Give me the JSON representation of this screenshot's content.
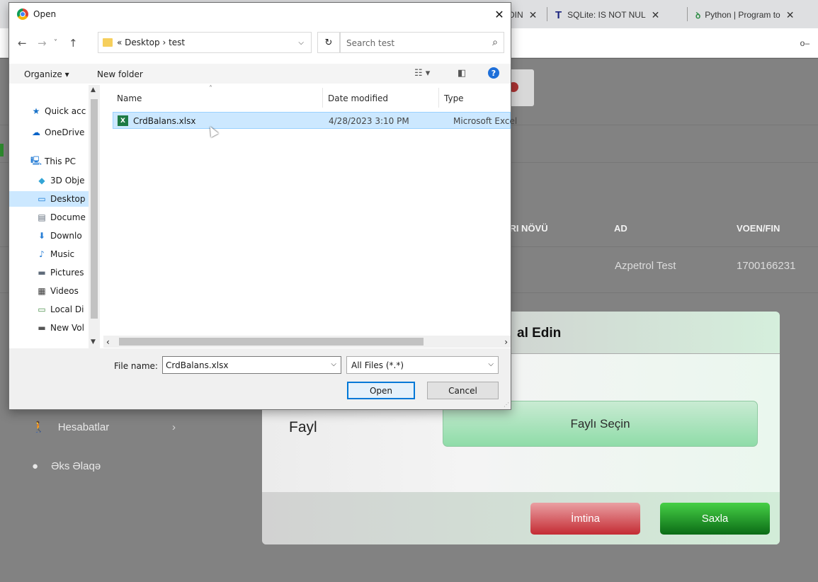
{
  "browser": {
    "tabs": [
      {
        "label": "DIN"
      },
      {
        "label": "SQLite: IS NOT NUL",
        "icon": "T"
      },
      {
        "label": "Python | Program to",
        "icon": "ꝺ"
      }
    ]
  },
  "app": {
    "table_headers": {
      "type": "ƏRI NÖVÜ",
      "name": "AD",
      "voen": "VOEN/FIN"
    },
    "row": {
      "name": "Azpetrol Test",
      "voen": "1700166231"
    },
    "sidebar": [
      {
        "label": "Hesabatlar",
        "icon": "person-icon"
      },
      {
        "label": "Əks Əlaqə",
        "icon": "chat-icon"
      }
    ],
    "modal": {
      "title": "al Edin",
      "field_label": "Fayl",
      "choose_button": "Faylı Seçin",
      "cancel_button": "İmtina",
      "save_button": "Saxla"
    }
  },
  "dialog": {
    "title": "Open",
    "path": "«  Desktop  ›  test",
    "search_placeholder": "Search test",
    "toolbar": {
      "organize": "Organize ▾",
      "new_folder": "New folder"
    },
    "nav": [
      {
        "label": "Quick acc",
        "icon": "★",
        "color": "#1a73c9"
      },
      {
        "label": "OneDrive",
        "icon": "☁",
        "color": "#0a64c8"
      },
      {
        "label": "This PC",
        "icon": "🖳",
        "color": "#2a7fd6"
      },
      {
        "label": "3D Obje",
        "icon": "◆",
        "color": "#33a5d6"
      },
      {
        "label": "Desktop",
        "icon": "▭",
        "color": "#1c7cd6"
      },
      {
        "label": "Docume",
        "icon": "▤",
        "color": "#5f6b7a"
      },
      {
        "label": "Downlo",
        "icon": "⬇",
        "color": "#2a7fd6"
      },
      {
        "label": "Music",
        "icon": "♪",
        "color": "#2a7fd6"
      },
      {
        "label": "Pictures",
        "icon": "▬",
        "color": "#5f6b7a"
      },
      {
        "label": "Videos",
        "icon": "▦",
        "color": "#3a3a3a"
      },
      {
        "label": "Local Di",
        "icon": "▭",
        "color": "#4b8f4b"
      },
      {
        "label": "New Vol",
        "icon": "▬",
        "color": "#555"
      }
    ],
    "columns": {
      "name": "Name",
      "date": "Date modified",
      "type": "Type"
    },
    "files": [
      {
        "name": "CrdBalans.xlsx",
        "date": "4/28/2023 3:10 PM",
        "type": "Microsoft Excel"
      }
    ],
    "file_name_label": "File name:",
    "file_name_value": "CrdBalans.xlsx",
    "file_type": "All Files (*.*)",
    "open_button": "Open",
    "cancel_button": "Cancel"
  }
}
